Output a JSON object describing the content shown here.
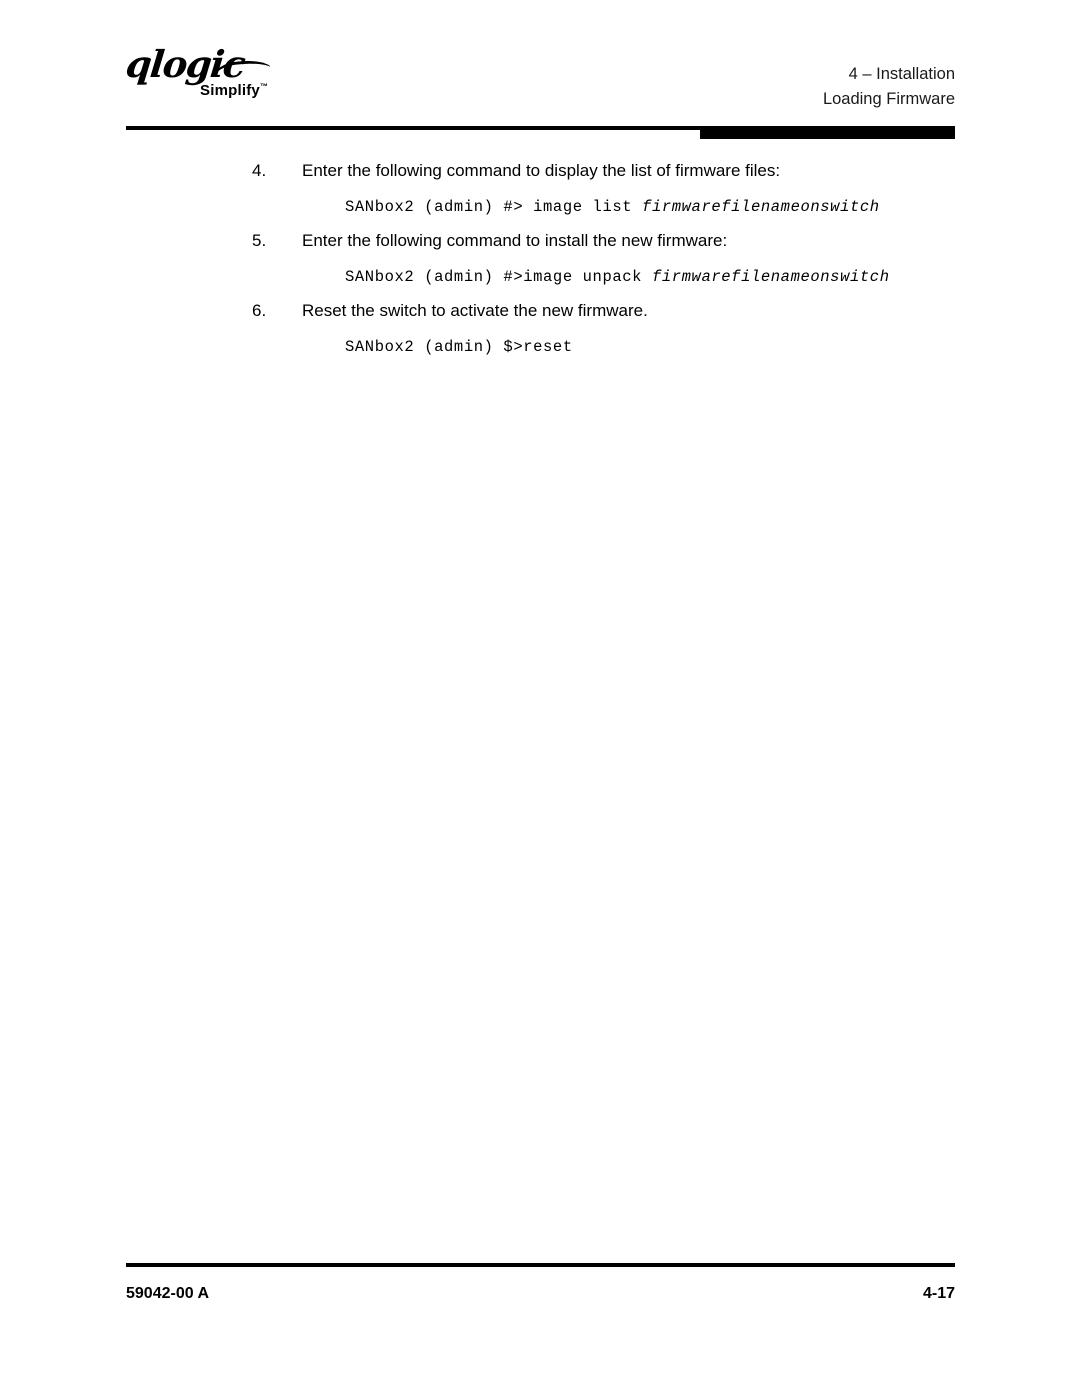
{
  "header": {
    "logo": {
      "wordmark": "qlogic",
      "tagline": "Simplify",
      "trademark": "™"
    },
    "chapter": "4 – Installation",
    "section": "Loading Firmware"
  },
  "body": {
    "steps": [
      {
        "number": "4.",
        "text": "Enter the following command to display the list of firmware files:",
        "command_prefix": "SANbox2 (admin) #> image list ",
        "command_arg": "firmwarefilenameonswitch"
      },
      {
        "number": "5.",
        "text": "Enter the following command to install the new firmware:",
        "command_prefix": "SANbox2 (admin) #>image unpack ",
        "command_arg": "firmwarefilenameonswitch"
      },
      {
        "number": "6.",
        "text": "Reset the switch to activate the new firmware.",
        "command_prefix": "SANbox2 (admin) $>reset",
        "command_arg": ""
      }
    ]
  },
  "footer": {
    "document_number": "59042-00 A",
    "page_number": "4-17"
  },
  "colors": {
    "text": "#000000",
    "rule": "#000000",
    "background": "#ffffff"
  }
}
